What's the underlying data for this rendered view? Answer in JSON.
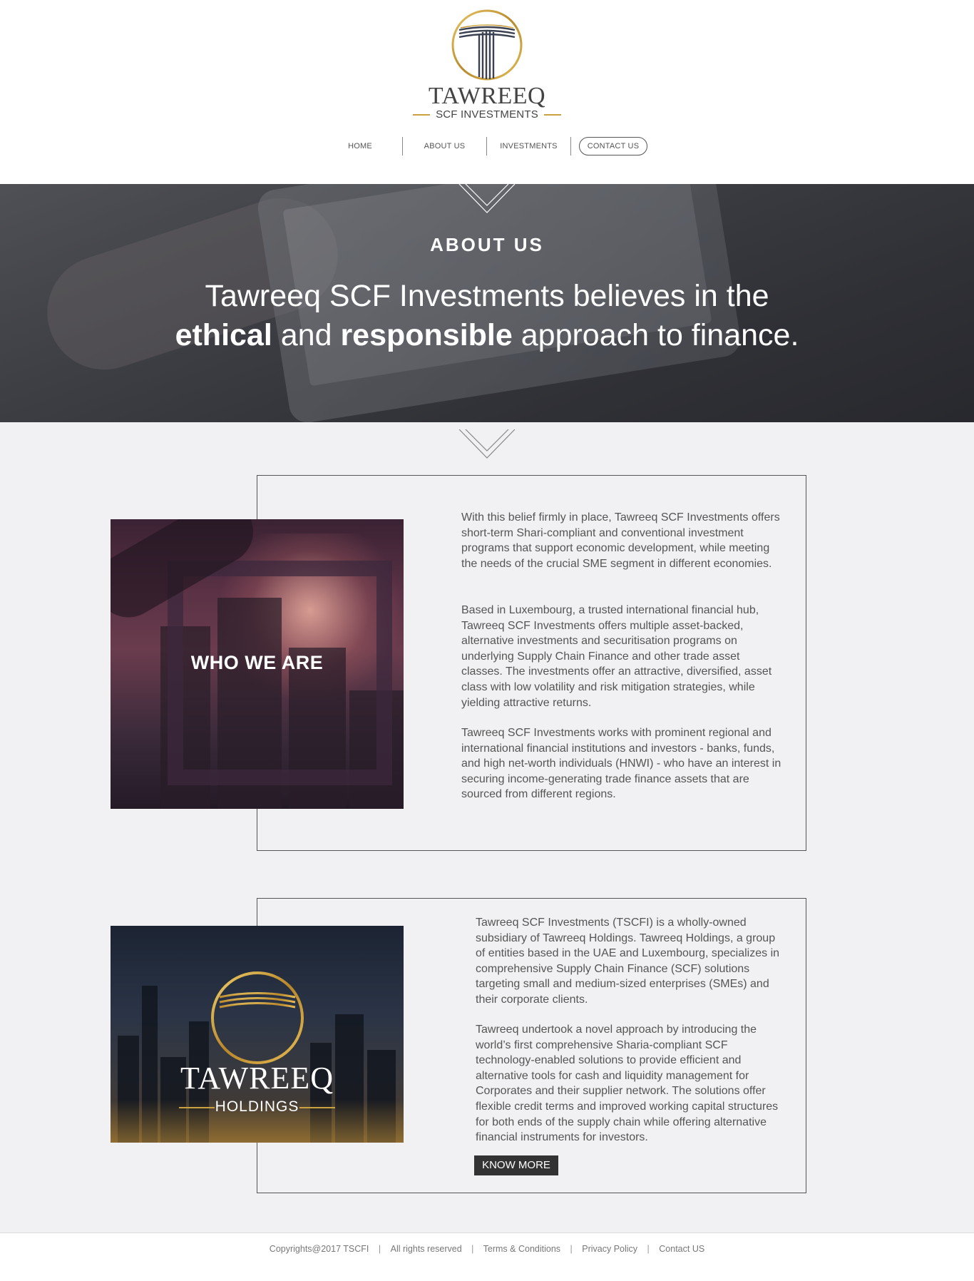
{
  "header": {
    "brand_name": "TAWREEQ",
    "brand_sub": "SCF INVESTMENTS"
  },
  "nav": {
    "items": [
      {
        "label": "HOME"
      },
      {
        "label": "ABOUT US"
      },
      {
        "label": "INVESTMENTS"
      },
      {
        "label": "CONTACT US"
      }
    ]
  },
  "hero": {
    "title": "ABOUT US",
    "line1": "Tawreeq SCF Investments believes in the",
    "line2_bold1": "ethical",
    "line2_mid": " and ",
    "line2_bold2": "responsible",
    "line2_end": " approach to finance."
  },
  "who_we_are": {
    "label": "WHO WE ARE",
    "paragraphs": [
      "With this belief firmly in place, Tawreeq SCF Investments offers short-term Shari-compliant and conventional investment programs that support economic development, while meeting the needs of the crucial SME segment in different economies.",
      "Based in Luxembourg, a trusted international financial hub, Tawreeq SCF Investments offers multiple asset-backed, alternative investments and securitisation programs on underlying Supply Chain Finance and other trade asset classes. The investments offer an attractive, diversified, asset class with low volatility and risk mitigation strategies, while yielding attractive returns.",
      "Tawreeq SCF Investments works with prominent regional and international financial institutions and investors - banks, funds, and high net-worth individuals (HNWI) - who have an interest in securing income-generating trade finance assets that are sourced from different regions."
    ]
  },
  "holdings": {
    "logo_word": "TAWREEQ",
    "logo_sub": "HOLDINGS",
    "paragraphs": [
      "Tawreeq SCF Investments (TSCFI) is a wholly-owned subsidiary of Tawreeq Holdings. Tawreeq Holdings, a group of entities based in the UAE and Luxembourg, specializes in comprehensive Supply Chain Finance (SCF) solutions targeting small and medium-sized enterprises (SMEs) and their corporate clients.",
      "Tawreeq undertook a novel approach by introducing the world’s first comprehensive Sharia-compliant SCF technology-enabled solutions to provide efficient and alternative tools for cash and liquidity management for Corporates and their supplier network. The solutions offer flexible credit terms and improved working capital structures for both ends of the supply chain while offering alternative financial instruments for investors."
    ],
    "button_label": "KNOW MORE"
  },
  "footer": {
    "copyright": "Copyrights@2017 TSCFI",
    "rights": "All rights reserved",
    "terms": "Terms & Conditions",
    "privacy": "Privacy Policy",
    "contact": "Contact US",
    "separator": "|"
  },
  "colors": {
    "gold": "#c9a23f",
    "dark_button": "#333333",
    "main_bg": "#f1f1f3"
  }
}
